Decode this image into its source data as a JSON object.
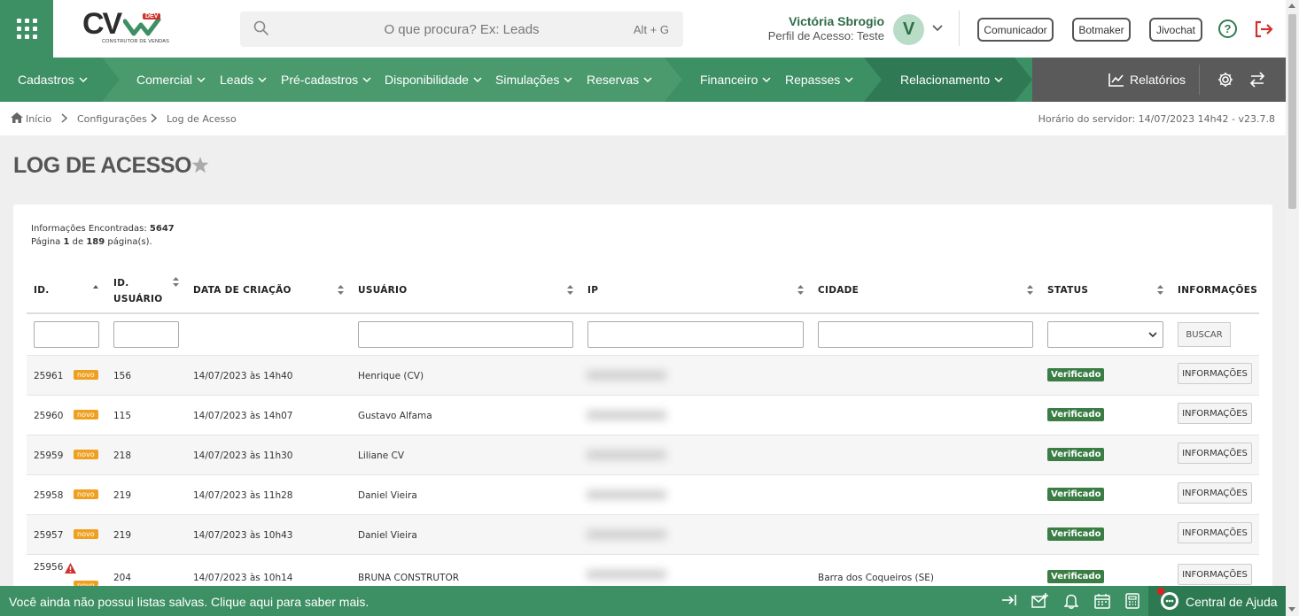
{
  "header": {
    "logo_text": "CV",
    "logo_badge": "DEV",
    "logo_sub": "CONSTRUTOR DE VENDAS",
    "search_placeholder": "O que procura? Ex: Leads",
    "search_shortcut": "Alt + G",
    "user_name": "Victória Sbrogio",
    "user_profile": "Perfil de Acesso: Teste",
    "avatar_letter": "V",
    "buttons": [
      "Comunicador",
      "Botmaker",
      "Jivochat"
    ],
    "help_label": "?"
  },
  "nav": {
    "items": [
      "Cadastros",
      "Comercial",
      "Leads",
      "Pré-cadastros",
      "Disponibilidade",
      "Simulações",
      "Reservas",
      "Financeiro",
      "Repasses",
      "Relacionamento"
    ],
    "reports_label": "Relatórios"
  },
  "breadcrumb": {
    "items": [
      "Início",
      "Configurações",
      "Log de Acesso"
    ],
    "server_time": "Horário do servidor: 14/07/2023 14h42 - v23.7.8"
  },
  "page": {
    "title": "LOG DE ACESSO",
    "info_found_label": "Informações Encontradas:",
    "info_found_count": "5647",
    "page_label": "Página",
    "page_current": "1",
    "page_of": "de",
    "page_total": "189",
    "page_suffix": "página(s)."
  },
  "table": {
    "columns": [
      "ID.",
      "ID. USUÁRIO",
      "DATA DE CRIAÇÃO",
      "USUÁRIO",
      "IP",
      "CIDADE",
      "STATUS",
      "INFORMAÇÕES"
    ],
    "search_button": "BUSCAR",
    "novo_label": "novo",
    "info_button": "INFORMAÇÕES",
    "rows": [
      {
        "id": "25961",
        "user_id": "156",
        "created": "14/07/2023 às 14h40",
        "user": "Henrique (CV)",
        "city": "",
        "status": "Verificado"
      },
      {
        "id": "25960",
        "user_id": "115",
        "created": "14/07/2023 às 14h07",
        "user": "Gustavo Alfama",
        "city": "",
        "status": "Verificado"
      },
      {
        "id": "25959",
        "user_id": "218",
        "created": "14/07/2023 às 11h30",
        "user": "Liliane CV",
        "city": "",
        "status": "Verificado"
      },
      {
        "id": "25958",
        "user_id": "219",
        "created": "14/07/2023 às 11h28",
        "user": "Daniel Vieira",
        "city": "",
        "status": "Verificado"
      },
      {
        "id": "25957",
        "user_id": "219",
        "created": "14/07/2023 às 10h43",
        "user": "Daniel Vieira",
        "city": "",
        "status": "Verificado"
      },
      {
        "id": "25956",
        "user_id": "204",
        "created": "14/07/2023 às 10h14",
        "user": "BRUNA CONSTRUTOR",
        "city": "Barra dos Coqueiros (SE)",
        "status": "Verificado"
      }
    ]
  },
  "footer": {
    "message": "Você ainda não possui listas salvas. Clique aqui para saber mais.",
    "help_center": "Central de Ajuda"
  },
  "colors": {
    "brand_green": "#3d8f64",
    "nav_dark": "#5a5a5a",
    "status_green": "#3a7d45",
    "novo_orange": "#f0a020"
  }
}
